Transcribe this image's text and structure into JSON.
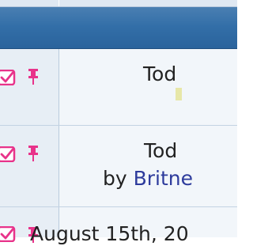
{
  "rows": [
    {
      "date_text": "Tod",
      "checked": true,
      "pinned": true
    },
    {
      "date_text": "Tod",
      "by_prefix": "by ",
      "author": "Britne",
      "checked": true,
      "pinned": true
    },
    {
      "date_text": "August 15th, 20",
      "checked": true,
      "pinned": true
    }
  ],
  "colors": {
    "header": "#336fa8",
    "accent_pink": "#e8338a",
    "author_link": "#2d3b9c",
    "row_bg": "#f2f6fa",
    "icon_col_bg": "#e7eef5"
  },
  "icons": {
    "check": "checkbox-checked-icon",
    "pin": "pin-icon"
  }
}
